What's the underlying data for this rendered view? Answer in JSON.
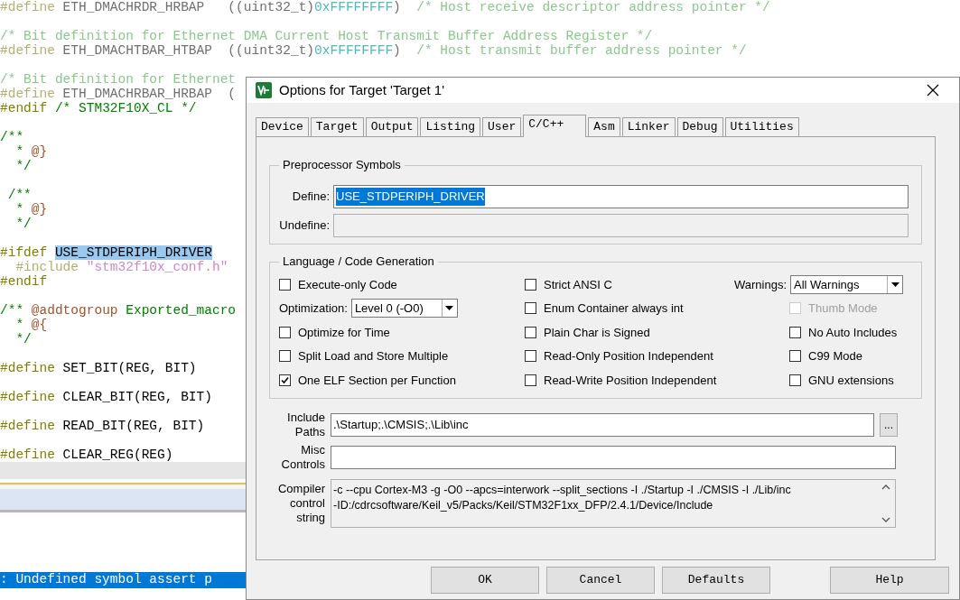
{
  "editor": {
    "blocks": [
      {
        "lines": [
          {
            "faded": true,
            "segments": [
              {
                "kind": "directive",
                "text": "#define"
              },
              {
                "kind": "plain",
                "text": " ETH_DMACHRDR_HRBAP   ((uint32_t)"
              },
              {
                "kind": "number",
                "text": "0xFFFFFFFF"
              },
              {
                "kind": "plain",
                "text": ")"
              },
              {
                "kind": "comment",
                "text": "  /* Host receive descriptor address pointer */"
              }
            ]
          }
        ]
      },
      {
        "lines": [
          {
            "faded": true,
            "segments": [
              {
                "kind": "comment",
                "text": "/* Bit definition for Ethernet DMA Current Host Transmit Buffer Address Register */"
              }
            ]
          },
          {
            "faded": true,
            "segments": [
              {
                "kind": "directive",
                "text": "#define"
              },
              {
                "kind": "plain",
                "text": " ETH_DMACHTBAR_HTBAP  ((uint32_t)"
              },
              {
                "kind": "number",
                "text": "0xFFFFFFFF"
              },
              {
                "kind": "plain",
                "text": ")"
              },
              {
                "kind": "comment",
                "text": "  /* Host transmit buffer address pointer */"
              }
            ]
          }
        ]
      },
      {
        "lines": [
          {
            "faded": true,
            "segments": [
              {
                "kind": "comment",
                "text": "/* Bit definition for Ethernet"
              }
            ]
          },
          {
            "faded": true,
            "segments": [
              {
                "kind": "directive",
                "text": "#define"
              },
              {
                "kind": "plain",
                "text": " ETH_DMACHRBAR_HRBAP  ("
              }
            ]
          },
          {
            "faded": false,
            "segments": [
              {
                "kind": "directive",
                "text": "#endif"
              },
              {
                "kind": "comment",
                "text": " /* STM32F10X_CL */"
              }
            ]
          }
        ]
      },
      {
        "lines": [
          {
            "faded": false,
            "segments": [
              {
                "kind": "comment",
                "text": "/**"
              }
            ]
          },
          {
            "faded": false,
            "segments": [
              {
                "kind": "comment",
                "text": "  * "
              },
              {
                "kind": "doctag",
                "text": "@}"
              }
            ]
          },
          {
            "faded": false,
            "segments": [
              {
                "kind": "comment",
                "text": "  */"
              }
            ]
          }
        ]
      },
      {
        "lines": [
          {
            "faded": false,
            "segments": [
              {
                "kind": "comment",
                "text": " /**"
              }
            ]
          },
          {
            "faded": false,
            "segments": [
              {
                "kind": "comment",
                "text": "  * "
              },
              {
                "kind": "doctag",
                "text": "@}"
              }
            ]
          },
          {
            "faded": false,
            "segments": [
              {
                "kind": "comment",
                "text": "  */"
              }
            ]
          }
        ]
      },
      {
        "lines": [
          {
            "faded": false,
            "segments": [
              {
                "kind": "directive",
                "text": "#ifdef "
              },
              {
                "kind": "highlight",
                "text": "USE_STDPERIPH_DRIVER"
              }
            ]
          },
          {
            "faded": true,
            "segments": [
              {
                "kind": "directive",
                "text": "  #include "
              },
              {
                "kind": "string",
                "text": "\"stm32f10x_conf.h\""
              }
            ]
          },
          {
            "faded": false,
            "segments": [
              {
                "kind": "directive",
                "text": "#endif"
              }
            ]
          }
        ]
      },
      {
        "lines": [
          {
            "faded": false,
            "segments": [
              {
                "kind": "comment",
                "text": "/** "
              },
              {
                "kind": "doctag",
                "text": "@addtogroup"
              },
              {
                "kind": "comment",
                "text": " Exported_macro"
              }
            ]
          },
          {
            "faded": false,
            "segments": [
              {
                "kind": "comment",
                "text": "  * "
              },
              {
                "kind": "doctag",
                "text": "@{"
              }
            ]
          },
          {
            "faded": false,
            "segments": [
              {
                "kind": "comment",
                "text": "  */"
              }
            ]
          }
        ]
      },
      {
        "lines": [
          {
            "faded": false,
            "segments": [
              {
                "kind": "directive",
                "text": "#define"
              },
              {
                "kind": "plain",
                "text": " SET_BIT(REG, BIT)"
              }
            ]
          }
        ]
      },
      {
        "lines": [
          {
            "faded": false,
            "segments": [
              {
                "kind": "directive",
                "text": "#define"
              },
              {
                "kind": "plain",
                "text": " CLEAR_BIT(REG, BIT)"
              }
            ]
          }
        ]
      },
      {
        "lines": [
          {
            "faded": false,
            "segments": [
              {
                "kind": "directive",
                "text": "#define"
              },
              {
                "kind": "plain",
                "text": " READ_BIT(REG, BIT)"
              }
            ]
          }
        ]
      },
      {
        "lines": [
          {
            "faded": false,
            "segments": [
              {
                "kind": "directive",
                "text": "#define"
              },
              {
                "kind": "plain",
                "text": " CLEAR_REG(REG)"
              }
            ]
          }
        ]
      }
    ]
  },
  "output": {
    "message": ": Undefined symbol assert p",
    "selected": true
  },
  "dialog": {
    "title": "Options for Target 'Target 1'",
    "tabs": [
      {
        "label": "Device",
        "selected": false
      },
      {
        "label": "Target",
        "selected": false
      },
      {
        "label": "Output",
        "selected": false
      },
      {
        "label": "Listing",
        "selected": false
      },
      {
        "label": "User",
        "selected": false
      },
      {
        "label": "C/C++",
        "selected": true
      },
      {
        "label": "Asm",
        "selected": false
      },
      {
        "label": "Linker",
        "selected": false
      },
      {
        "label": "Debug",
        "selected": false
      },
      {
        "label": "Utilities",
        "selected": false
      }
    ],
    "preprocessor": {
      "title": "Preprocessor Symbols",
      "define": {
        "label": "Define:",
        "value": "USE_STDPERIPH_DRIVER",
        "selected": true
      },
      "undefine": {
        "label": "Undefine:",
        "disabled": true
      }
    },
    "language": {
      "title": "Language / Code Generation",
      "columns": [
        [
          {
            "kind": "checkbox",
            "label": "Execute-only Code",
            "checked": false,
            "disabled": false
          },
          {
            "kind": "select",
            "label": "Optimization:",
            "value": "Level 0 (-O0)"
          },
          {
            "kind": "checkbox",
            "label": "Optimize for Time",
            "checked": false,
            "disabled": false
          },
          {
            "kind": "checkbox",
            "label": "Split Load and Store Multiple",
            "checked": false,
            "disabled": false
          },
          {
            "kind": "checkbox",
            "label": "One ELF Section per Function",
            "checked": true,
            "disabled": false
          }
        ],
        [
          {
            "kind": "checkbox",
            "label": "Strict ANSI C",
            "checked": false,
            "disabled": false
          },
          {
            "kind": "checkbox",
            "label": "Enum Container always int",
            "checked": false,
            "disabled": false
          },
          {
            "kind": "checkbox",
            "label": "Plain Char is Signed",
            "checked": false,
            "disabled": false
          },
          {
            "kind": "checkbox",
            "label": "Read-Only Position Independent",
            "checked": false,
            "disabled": false
          },
          {
            "kind": "checkbox",
            "label": "Read-Write Position Independent",
            "checked": false,
            "disabled": false
          }
        ],
        [
          {
            "kind": "select",
            "label": "Warnings:",
            "value": "All Warnings"
          },
          {
            "kind": "checkbox",
            "label": "Thumb Mode",
            "checked": false,
            "disabled": true
          },
          {
            "kind": "checkbox",
            "label": "No Auto Includes",
            "checked": false,
            "disabled": false
          },
          {
            "kind": "checkbox",
            "label": "C99 Mode",
            "checked": false,
            "disabled": false
          },
          {
            "kind": "checkbox",
            "label": "GNU extensions",
            "checked": false,
            "disabled": false
          }
        ]
      ]
    },
    "include_paths": {
      "label": "Include Paths",
      "value": ".\\Startup;.\\CMSIS;.\\Lib\\inc",
      "browse": "..."
    },
    "misc_controls": {
      "label": "Misc Controls"
    },
    "compiler_control": {
      "label": "Compiler control string",
      "lines": [
        "-c --cpu Cortex-M3 -g -O0 --apcs=interwork --split_sections -I ./Startup -I ./CMSIS -I ./Lib/inc",
        "-ID:/cdrcsoftware/Keil_v5/Packs/Keil/STM32F1xx_DFP/2.4.1/Device/Include"
      ]
    },
    "buttons": [
      "OK",
      "Cancel",
      "Defaults",
      "Help"
    ]
  }
}
